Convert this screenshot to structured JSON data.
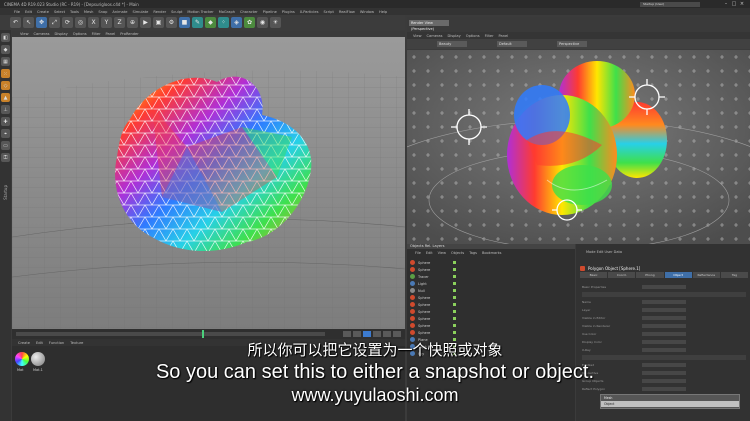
{
  "titlebar": {
    "title": "CINEMA 4D R19.023 Studio (RC - R19) - [Depsurigloos.c4d *] - Main",
    "layout": "Startup (User)",
    "minimize": "–",
    "maximize": "□",
    "close": "×"
  },
  "menubar": {
    "items": [
      "File",
      "Edit",
      "Create",
      "Select",
      "Tools",
      "Mesh",
      "Snap",
      "Animate",
      "Simulate",
      "Render",
      "Sculpt",
      "Motion Tracker",
      "MoGraph",
      "Character",
      "Pipeline",
      "Plugins",
      "X-Particles",
      "Script",
      "RealFlow",
      "Window",
      "Help"
    ]
  },
  "toolbar": {
    "icons": [
      {
        "name": "undo-icon",
        "glyph": "↶",
        "color": "grey"
      },
      {
        "name": "live-select-icon",
        "glyph": "↖",
        "color": "grey"
      },
      {
        "name": "move-icon",
        "glyph": "✥",
        "color": "blue"
      },
      {
        "name": "scale-icon",
        "glyph": "⤢",
        "color": "grey"
      },
      {
        "name": "rotate-icon",
        "glyph": "⟳",
        "color": "grey"
      },
      {
        "name": "recent-tool-icon",
        "glyph": "◎",
        "color": "grey"
      },
      {
        "name": "x-axis-icon",
        "glyph": "X",
        "color": "grey"
      },
      {
        "name": "y-axis-icon",
        "glyph": "Y",
        "color": "grey"
      },
      {
        "name": "z-axis-icon",
        "glyph": "Z",
        "color": "grey"
      },
      {
        "name": "world-coord-icon",
        "glyph": "⊕",
        "color": "grey"
      },
      {
        "name": "render-view-icon",
        "glyph": "▶",
        "color": "grey"
      },
      {
        "name": "render-pv-icon",
        "glyph": "▣",
        "color": "grey"
      },
      {
        "name": "render-settings-icon",
        "glyph": "⚙",
        "color": "grey"
      },
      {
        "name": "cube-icon",
        "glyph": "■",
        "color": "blue"
      },
      {
        "name": "pen-icon",
        "glyph": "✎",
        "color": "teal"
      },
      {
        "name": "subdivision-icon",
        "glyph": "◆",
        "color": "green"
      },
      {
        "name": "cloner-icon",
        "glyph": "⁘",
        "color": "teal"
      },
      {
        "name": "deformer-icon",
        "glyph": "◈",
        "color": "blue"
      },
      {
        "name": "scene-icon",
        "glyph": "✿",
        "color": "green"
      },
      {
        "name": "camera-icon",
        "glyph": "◉",
        "color": "grey"
      },
      {
        "name": "light-icon",
        "glyph": "☀",
        "color": "grey"
      }
    ]
  },
  "left_tools": {
    "icons": [
      {
        "name": "make-editable-icon",
        "glyph": "◧",
        "color": "grey"
      },
      {
        "name": "model-mode-icon",
        "glyph": "◆",
        "color": "grey"
      },
      {
        "name": "texture-mode-icon",
        "glyph": "▦",
        "color": "grey"
      },
      {
        "name": "points-mode-icon",
        "glyph": "⁙",
        "color": "orange"
      },
      {
        "name": "edges-mode-icon",
        "glyph": "◇",
        "color": "orange"
      },
      {
        "name": "polygons-mode-icon",
        "glyph": "▲",
        "color": "orange"
      },
      {
        "name": "axis-mode-icon",
        "glyph": "⊥",
        "color": "grey"
      },
      {
        "name": "tweak-mode-icon",
        "glyph": "✚",
        "color": "grey"
      },
      {
        "name": "snap-icon",
        "glyph": "⌖",
        "color": "grey"
      },
      {
        "name": "workplane-icon",
        "glyph": "▭",
        "color": "grey"
      },
      {
        "name": "lock-icon",
        "glyph": "⚿",
        "color": "grey"
      }
    ],
    "vertical_label": "Startup"
  },
  "viewport_left": {
    "menu": [
      "View",
      "Cameras",
      "Display",
      "Options",
      "Filter",
      "Panel",
      "ProRender"
    ]
  },
  "viewport_right": {
    "tab": "Render View (Perspective)",
    "menu": [
      "View",
      "Cameras",
      "Display",
      "Options",
      "Filter",
      "Panel"
    ],
    "dropdowns": [
      "Beauty",
      "Default",
      "Perspective"
    ]
  },
  "materials": {
    "menu": [
      "Create",
      "Edit",
      "Function",
      "Texture"
    ],
    "items": [
      {
        "label": "Mat"
      },
      {
        "label": "Mat.1"
      }
    ]
  },
  "objects": {
    "title": "Objects Rel. Layers",
    "menu": [
      "File",
      "Edit",
      "View",
      "Objects",
      "Tags",
      "Bookmarks"
    ],
    "rows": [
      {
        "label": "Sphere",
        "color": "red"
      },
      {
        "label": "Sphere",
        "color": "red"
      },
      {
        "label": "Tracer",
        "color": "green"
      },
      {
        "label": "Light",
        "color": "blue"
      },
      {
        "label": "Null",
        "color": "grey"
      },
      {
        "label": "Sphere",
        "color": "red"
      },
      {
        "label": "Sphere",
        "color": "red"
      },
      {
        "label": "Sphere",
        "color": "red"
      },
      {
        "label": "Sphere",
        "color": "red"
      },
      {
        "label": "Sphere",
        "color": "red"
      },
      {
        "label": "Sphere",
        "color": "red"
      },
      {
        "label": "Plane",
        "color": "blue"
      },
      {
        "label": "Light",
        "color": "blue"
      },
      {
        "label": "Sky",
        "color": "blue"
      }
    ]
  },
  "attributes": {
    "header": "Mode Edit User Data",
    "object_name": "Polygon Object [Sphere.1]",
    "tabs": [
      "Basic",
      "Coord.",
      "Phong",
      "Object",
      "Reflectance",
      "Tag"
    ],
    "active_tab": "Object",
    "rows": [
      {
        "key": "Basic Properties"
      },
      {
        "key": "Name"
      },
      {
        "key": "Layer"
      },
      {
        "key": "Visible in Editor"
      },
      {
        "key": "Visible in Renderer"
      },
      {
        "key": "Use Color"
      },
      {
        "key": "Display Color"
      },
      {
        "key": "X-Ray"
      },
      {
        "key": "Enabled"
      },
      {
        "key": "Interactive"
      },
      {
        "key": "Group Objects"
      },
      {
        "key": "Reflect Polygon"
      }
    ],
    "popup_options": [
      "Mesh",
      "Object"
    ],
    "popup_selected": "Object"
  },
  "subtitles": {
    "chinese": "所以你可以把它设置为一个快照或对象",
    "english": "So you can set this to either a snapshot or object.",
    "watermark": "www.yuyulaoshi.com"
  },
  "colors": {
    "accent_blue": "#3f6fa8",
    "accent_orange": "#c9822a",
    "playhead_green": "#4bd07c"
  }
}
